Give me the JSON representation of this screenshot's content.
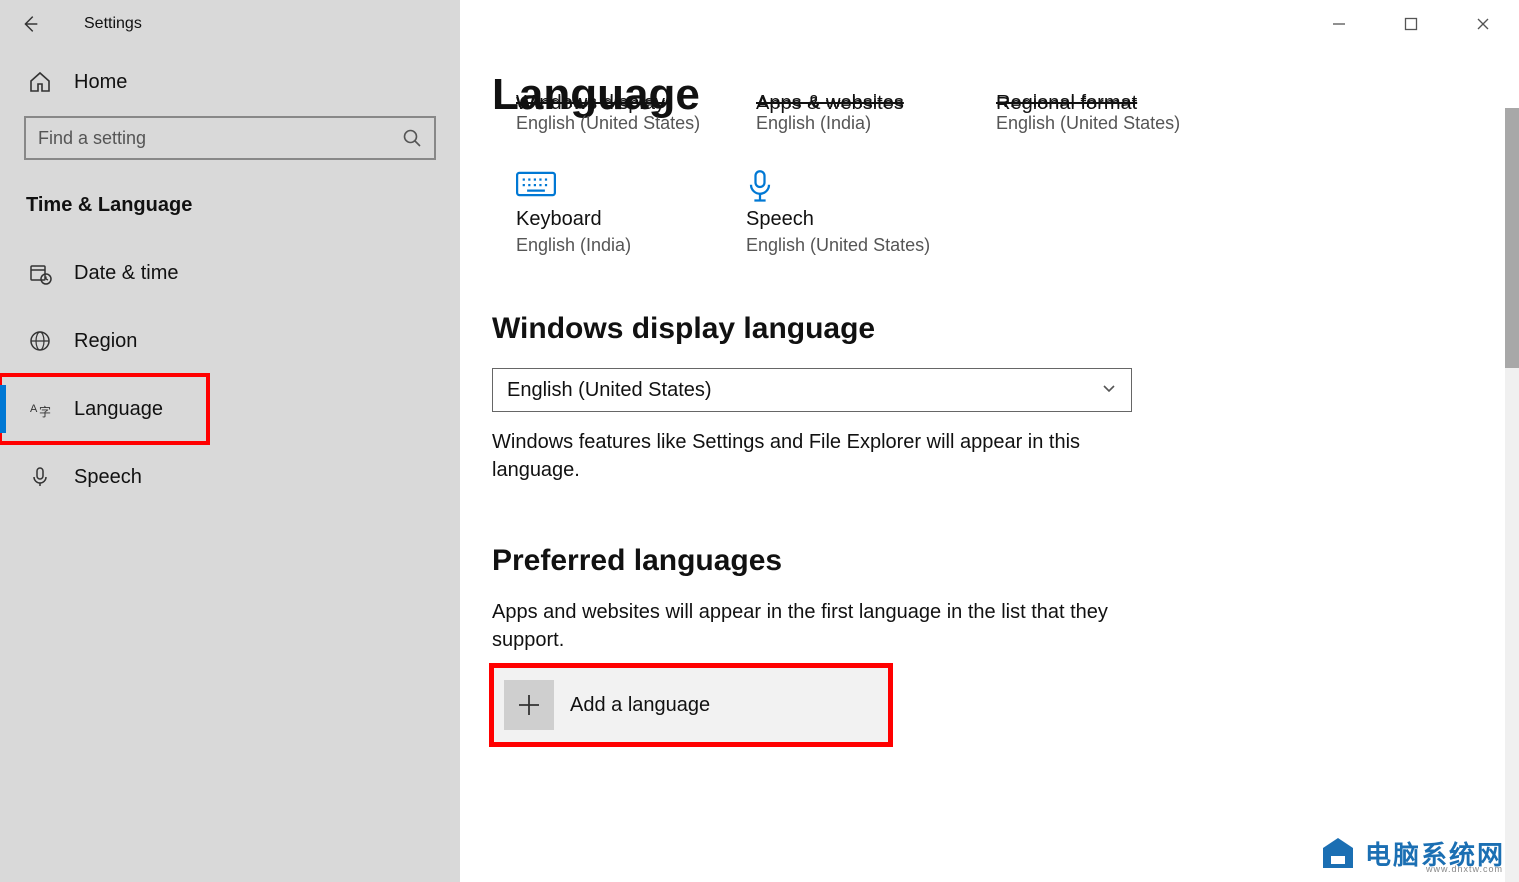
{
  "titlebar": {
    "app_title": "Settings"
  },
  "sidebar": {
    "home_label": "Home",
    "search_placeholder": "Find a setting",
    "category_label": "Time & Language",
    "items": [
      {
        "label": "Date & time",
        "icon": "calendar-clock-icon"
      },
      {
        "label": "Region",
        "icon": "globe-icon"
      },
      {
        "label": "Language",
        "icon": "language-icon",
        "active": true
      },
      {
        "label": "Speech",
        "icon": "microphone-icon"
      }
    ]
  },
  "main": {
    "page_title": "Language",
    "overview_cut": [
      {
        "title": "Windows display",
        "sub": "English (United States)"
      },
      {
        "title": "Apps & websites",
        "sub": "English (India)"
      },
      {
        "title": "Regional format",
        "sub": "English (United States)"
      }
    ],
    "overview_row2": [
      {
        "title": "Keyboard",
        "sub": "English (India)",
        "icon": "keyboard-icon"
      },
      {
        "title": "Speech",
        "sub": "English (United States)",
        "icon": "microphone-icon"
      }
    ],
    "display_lang": {
      "heading": "Windows display language",
      "selected": "English (United States)",
      "description": "Windows features like Settings and File Explorer will appear in this language."
    },
    "preferred": {
      "heading": "Preferred languages",
      "description": "Apps and websites will appear in the first language in the list that they support.",
      "add_label": "Add a language"
    }
  },
  "watermark": {
    "text": "电脑系统网",
    "sub": "www.dnxtw.com"
  }
}
